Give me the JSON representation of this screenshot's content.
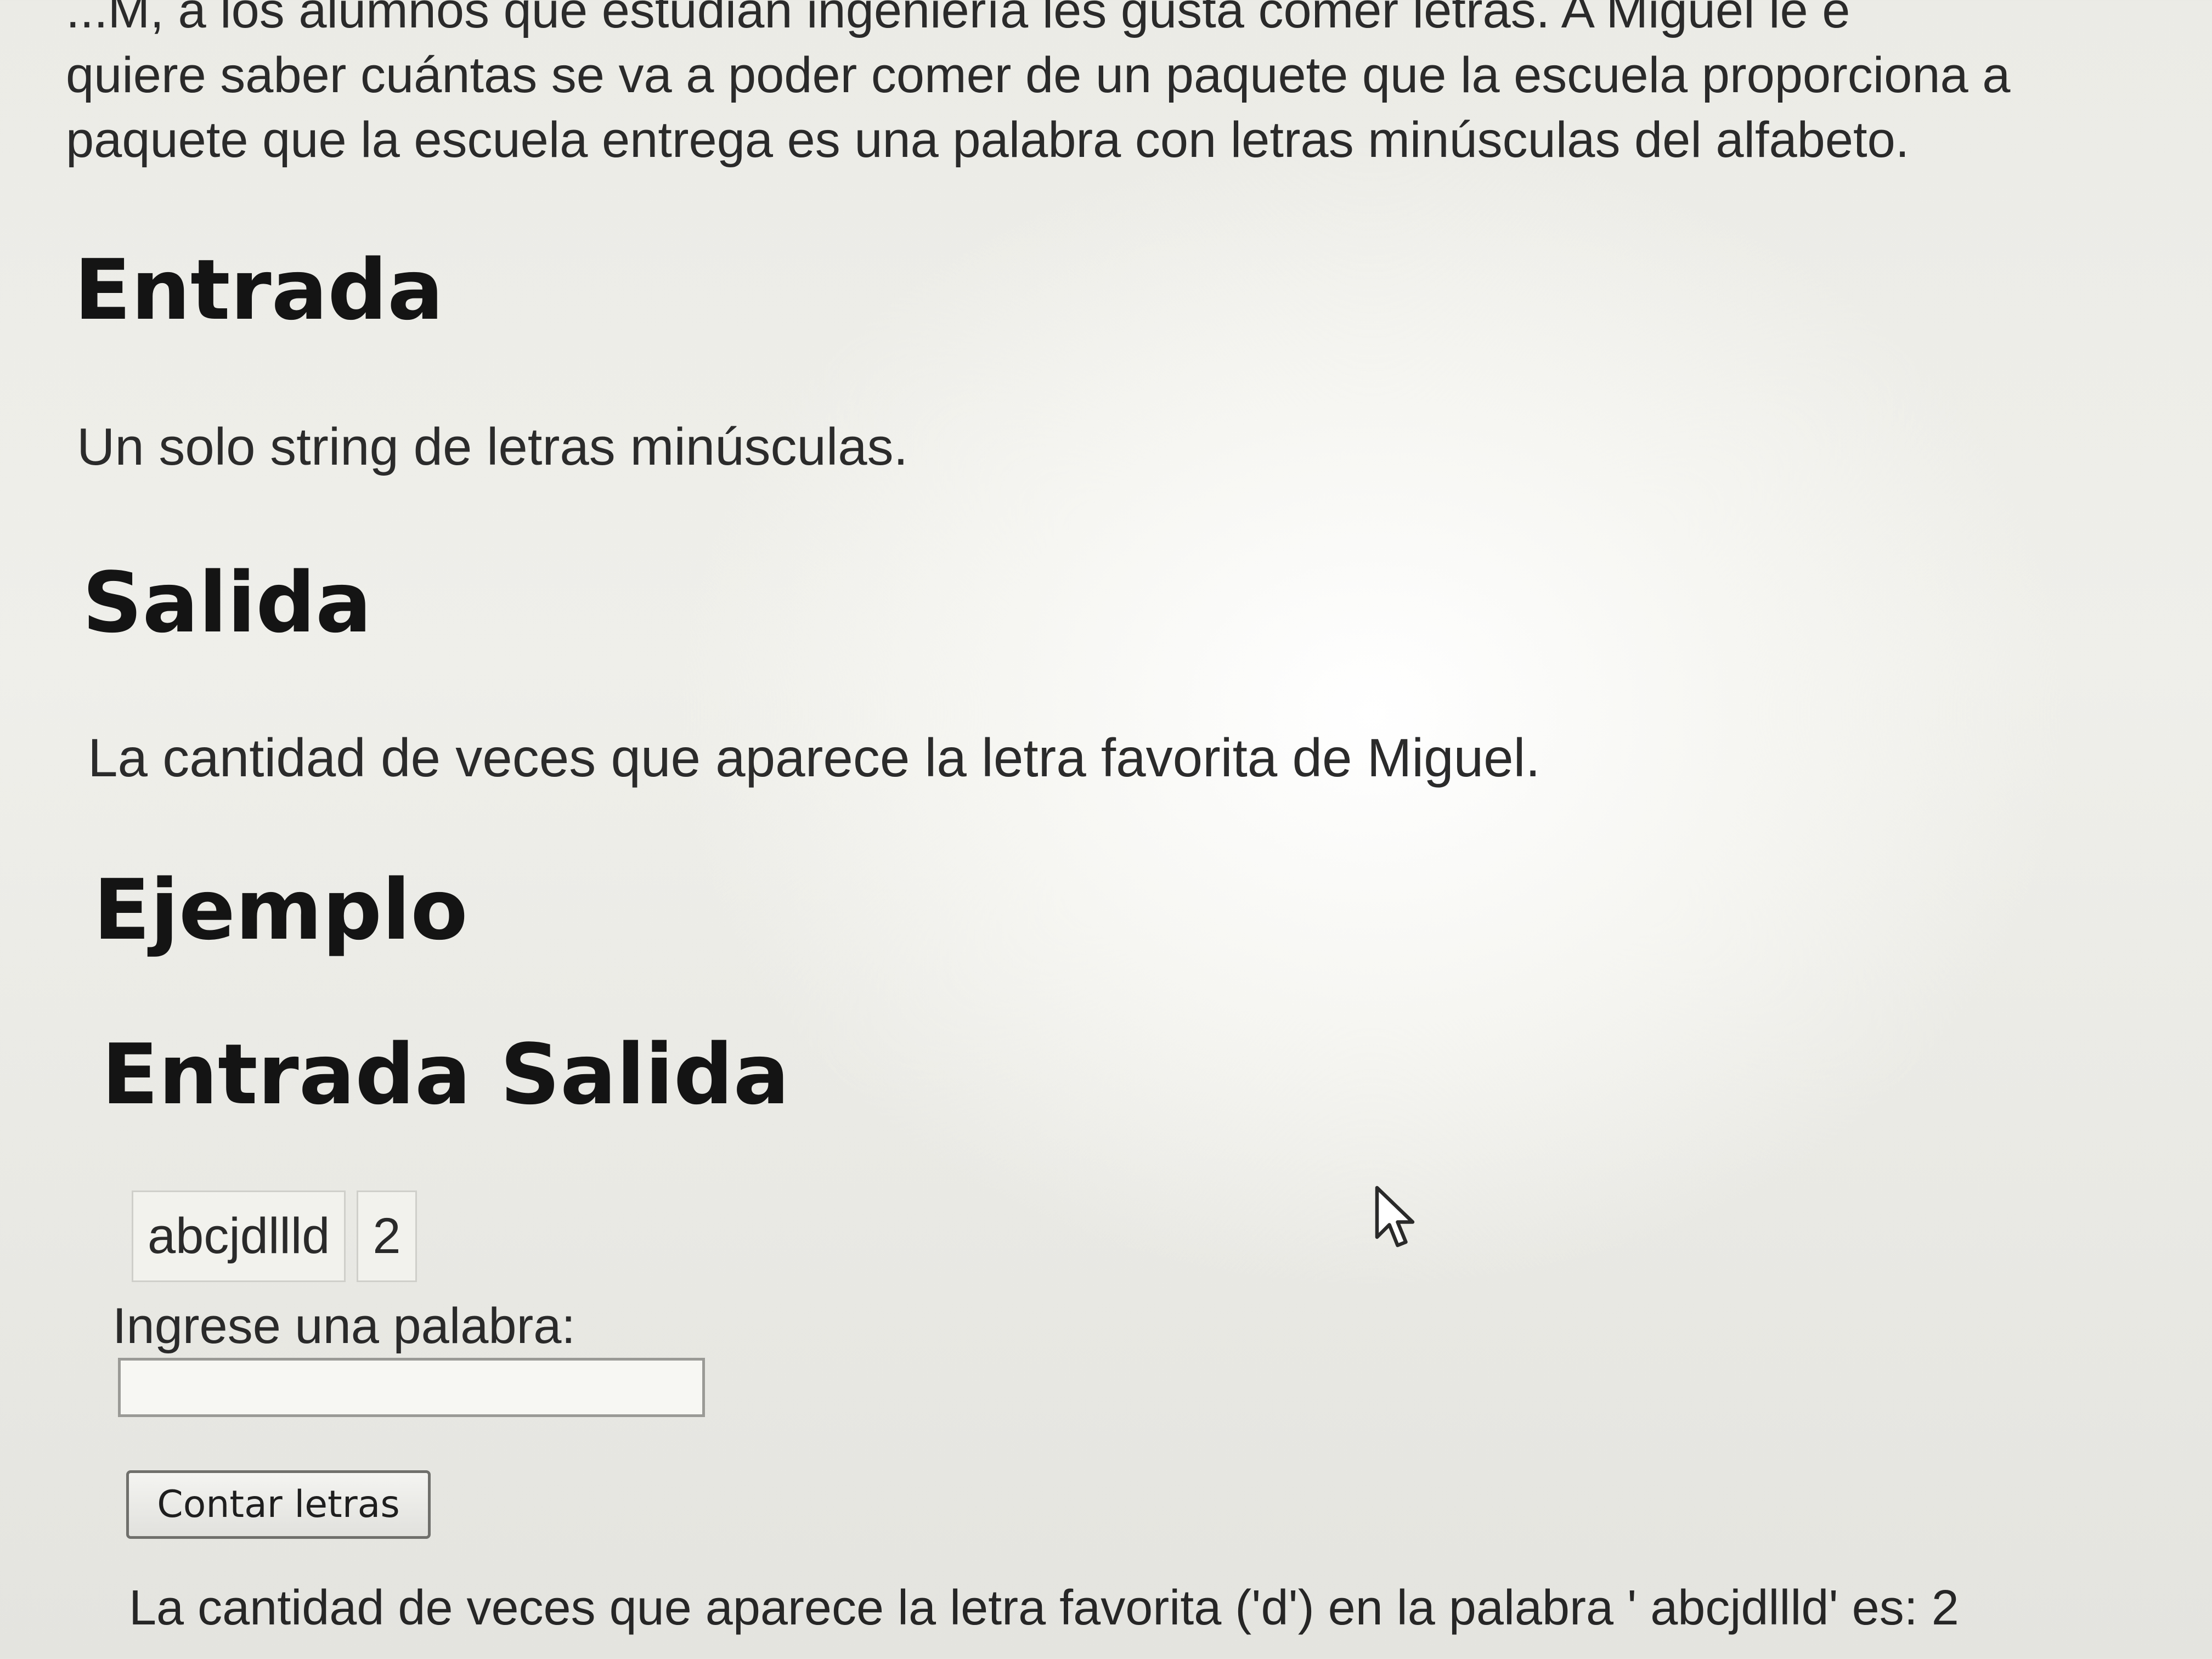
{
  "intro": {
    "lines": [
      "...M, a los alumnos que estudian ingeniería les gusta comer letras. A Miguel le e",
      "quiere saber cuántas se va a poder comer de un paquete que la escuela proporciona a",
      "paquete que la escuela entrega es una palabra con letras minúsculas del alfabeto."
    ]
  },
  "sections": {
    "entrada": {
      "heading": "Entrada",
      "text": "Un solo string de letras minúsculas."
    },
    "salida": {
      "heading": "Salida",
      "text": "La cantidad de veces que aparece la letra favorita de Miguel."
    },
    "ejemplo": {
      "heading": "Ejemplo"
    },
    "entrada_salida": {
      "heading": "Entrada Salida"
    }
  },
  "example_table": {
    "rows": [
      [
        "abcjdllld",
        "2"
      ]
    ]
  },
  "form": {
    "label": "Ingrese una palabra:",
    "input_value": "",
    "input_placeholder": "",
    "button_label": "Contar letras"
  },
  "result": {
    "text": "La cantidad de veces que aparece la letra favorita ('d') en la palabra ' abcjdllld' es: 2"
  },
  "icons": {
    "cursor": "mouse-pointer-icon"
  }
}
